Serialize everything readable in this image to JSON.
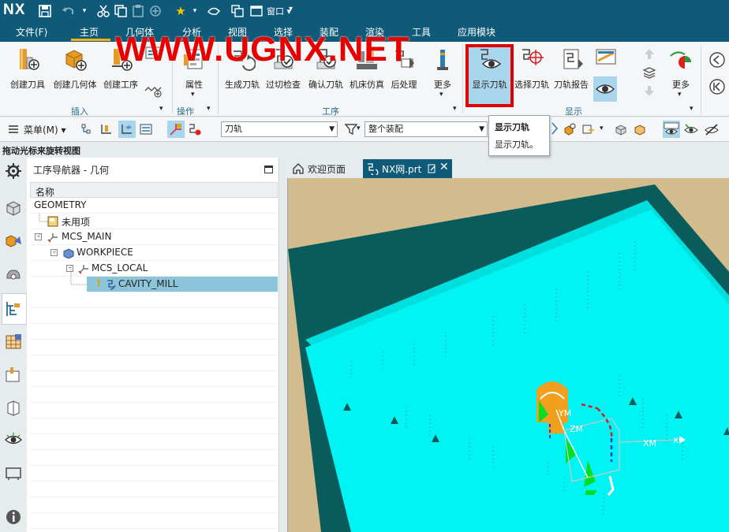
{
  "titlebar": {
    "app_name": "NX",
    "window_menu": "窗口"
  },
  "menubar": {
    "tabs": [
      {
        "label": "文件(F)"
      },
      {
        "label": "主页",
        "active": true
      },
      {
        "label": "几何体"
      },
      {
        "label": "分析"
      },
      {
        "label": "视图"
      },
      {
        "label": "选择"
      },
      {
        "label": "装配"
      },
      {
        "label": "渲染"
      },
      {
        "label": "工具"
      },
      {
        "label": "应用模块"
      }
    ],
    "accent_color": "#ffb300"
  },
  "ribbon": {
    "buttons": [
      {
        "label": "创建刀具"
      },
      {
        "label": "创建几何体"
      },
      {
        "label": "创建工序"
      },
      {
        "label": "属性"
      },
      {
        "label": "生成刀轨"
      },
      {
        "label": "过切检查"
      },
      {
        "label": "确认刀轨"
      },
      {
        "label": "机床仿真"
      },
      {
        "label": "后处理"
      },
      {
        "label": "更多"
      },
      {
        "label": "显示刀轨",
        "highlighted": true
      },
      {
        "label": "选择刀轨"
      },
      {
        "label": "刀轨报告"
      },
      {
        "label": "更多"
      }
    ],
    "groups": [
      {
        "label": "插入"
      },
      {
        "label": "操作"
      },
      {
        "label": "工序"
      },
      {
        "label": "显示"
      }
    ],
    "highlight_color": "#e00000"
  },
  "watermark": "WWW.UGNX.NET",
  "toolbar2": {
    "menu_label": "菜单(M)",
    "filter_combo": "刀轨",
    "assembly_combo": "整个装配"
  },
  "tooltip": {
    "title": "显示刀轨",
    "description": "显示刀轨。"
  },
  "status": {
    "hint": "拖动光标来旋转视图"
  },
  "navigator": {
    "title": "工序导航器 - 几何",
    "column_header": "名称",
    "rows": [
      {
        "label": "GEOMETRY"
      },
      {
        "label": "未用项"
      },
      {
        "label": "MCS_MAIN"
      },
      {
        "label": "WORKPIECE"
      },
      {
        "label": "MCS_LOCAL"
      },
      {
        "label": "CAVITY_MILL",
        "selected": true
      }
    ]
  },
  "view_tabs": {
    "welcome": "欢迎页面",
    "part": "NX网.prt"
  },
  "viewport": {
    "axis_labels": {
      "x": "XM",
      "z": "ZM",
      "y": "YM"
    },
    "colors": {
      "floor": "#00f4f4",
      "wall": "#0a5c5c",
      "background": "#d2bb8c",
      "tool": "#f0a01e"
    }
  }
}
